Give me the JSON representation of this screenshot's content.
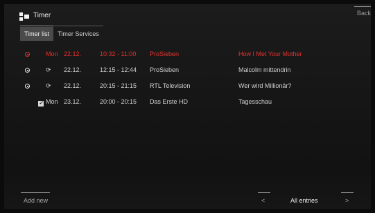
{
  "header": {
    "title": "Timer",
    "back_label": "Back"
  },
  "tabs": [
    {
      "label": "Timer list",
      "active": true
    },
    {
      "label": "Timer Services",
      "active": false
    }
  ],
  "timers": [
    {
      "status_icon": "record-dot-icon",
      "day": "Mon",
      "date": "22.12.",
      "time": "10:32 - 11:00",
      "channel": "ProSieben",
      "program": "How I Met Your Mother",
      "color": "#e8322e"
    },
    {
      "status_icon": "record-dot-icon",
      "type_icon": "series-repeat-icon",
      "day": "",
      "date": "22.12.",
      "time": "12:15 - 12:44",
      "channel": "ProSieben",
      "program": "Malcolm mittendrin",
      "color": "#d0d0d0"
    },
    {
      "status_icon": "record-dot-icon",
      "type_icon": "series-repeat-icon",
      "day": "",
      "date": "22.12.",
      "time": "20:15 - 21:15",
      "channel": "RTL Television",
      "program": "Wer wird Millionär?",
      "color": "#d0d0d0"
    },
    {
      "status_icon": "checkbox-icon",
      "day": "Mon",
      "date": "23.12.",
      "time": "20:00 - 20:15",
      "channel": "Das Erste HD",
      "program": "Tagesschau",
      "color": "#d0d0d0"
    }
  ],
  "footer": {
    "add_new_label": "Add new",
    "prev_label": "<",
    "filter_label": "All entries",
    "next_label": ">"
  }
}
